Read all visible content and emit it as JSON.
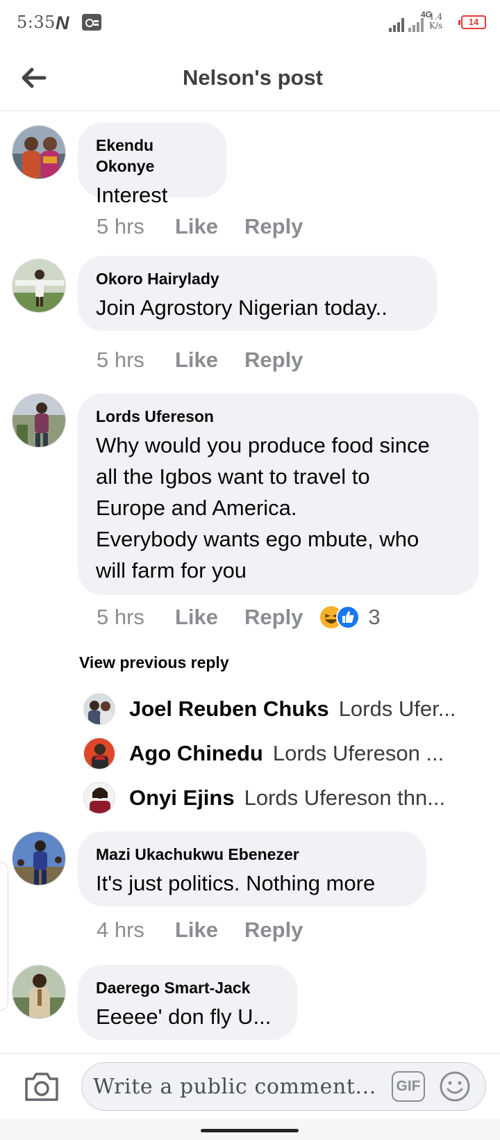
{
  "status_bar": {
    "time": "5:35",
    "carrier_logo": "N",
    "network": "4G",
    "speed_value": "1.4",
    "speed_unit": "K/s",
    "battery": "14"
  },
  "header": {
    "title": "Nelson's post",
    "back_icon": "arrow-left-icon"
  },
  "comments": [
    {
      "name": "Ekendu Okonye",
      "text": "Interest",
      "time": "5 hrs",
      "like": "Like",
      "reply": "Reply"
    },
    {
      "name": "Okoro Hairylady",
      "text": "Join Agrostory Nigerian today..",
      "time": "5 hrs",
      "like": "Like",
      "reply": "Reply"
    },
    {
      "name": "Lords Ufereson",
      "text_lines": [
        "Why would you produce food since",
        "all the Igbos want to travel to",
        "Europe and America.",
        "Everybody wants ego mbute, who",
        "will farm for you"
      ],
      "time": "5 hrs",
      "like": "Like",
      "reply": "Reply",
      "reaction_count": "3",
      "reaction_icons": [
        "haha-icon",
        "like-reaction-icon"
      ]
    },
    {
      "name": "Mazi Ukachukwu Ebenezer",
      "text": "It's just politics. Nothing more",
      "time": "4 hrs",
      "like": "Like",
      "reply": "Reply"
    },
    {
      "name": "Daerego Smart-Jack",
      "text": "Eeeee' don fly U..."
    }
  ],
  "replies": {
    "view_previous": "View previous reply",
    "items": [
      {
        "name": "Joel Reuben Chuks",
        "text": "Lords Ufer..."
      },
      {
        "name": "Ago Chinedu",
        "text": "Lords Ufereson ..."
      },
      {
        "name": "Onyi Ejins",
        "text": "Lords Ufereson thn..."
      }
    ]
  },
  "composer": {
    "placeholder": "Write a public comment...",
    "gif_label": "GIF",
    "camera_icon": "camera-icon",
    "emoji_icon": "emoji-icon"
  },
  "colors": {
    "bubble": "#f0f2f5",
    "meta_text": "#8a8d91",
    "like_blue": "#1877f2",
    "haha_yellow": "#f7b125",
    "battery_red": "#e53935"
  }
}
